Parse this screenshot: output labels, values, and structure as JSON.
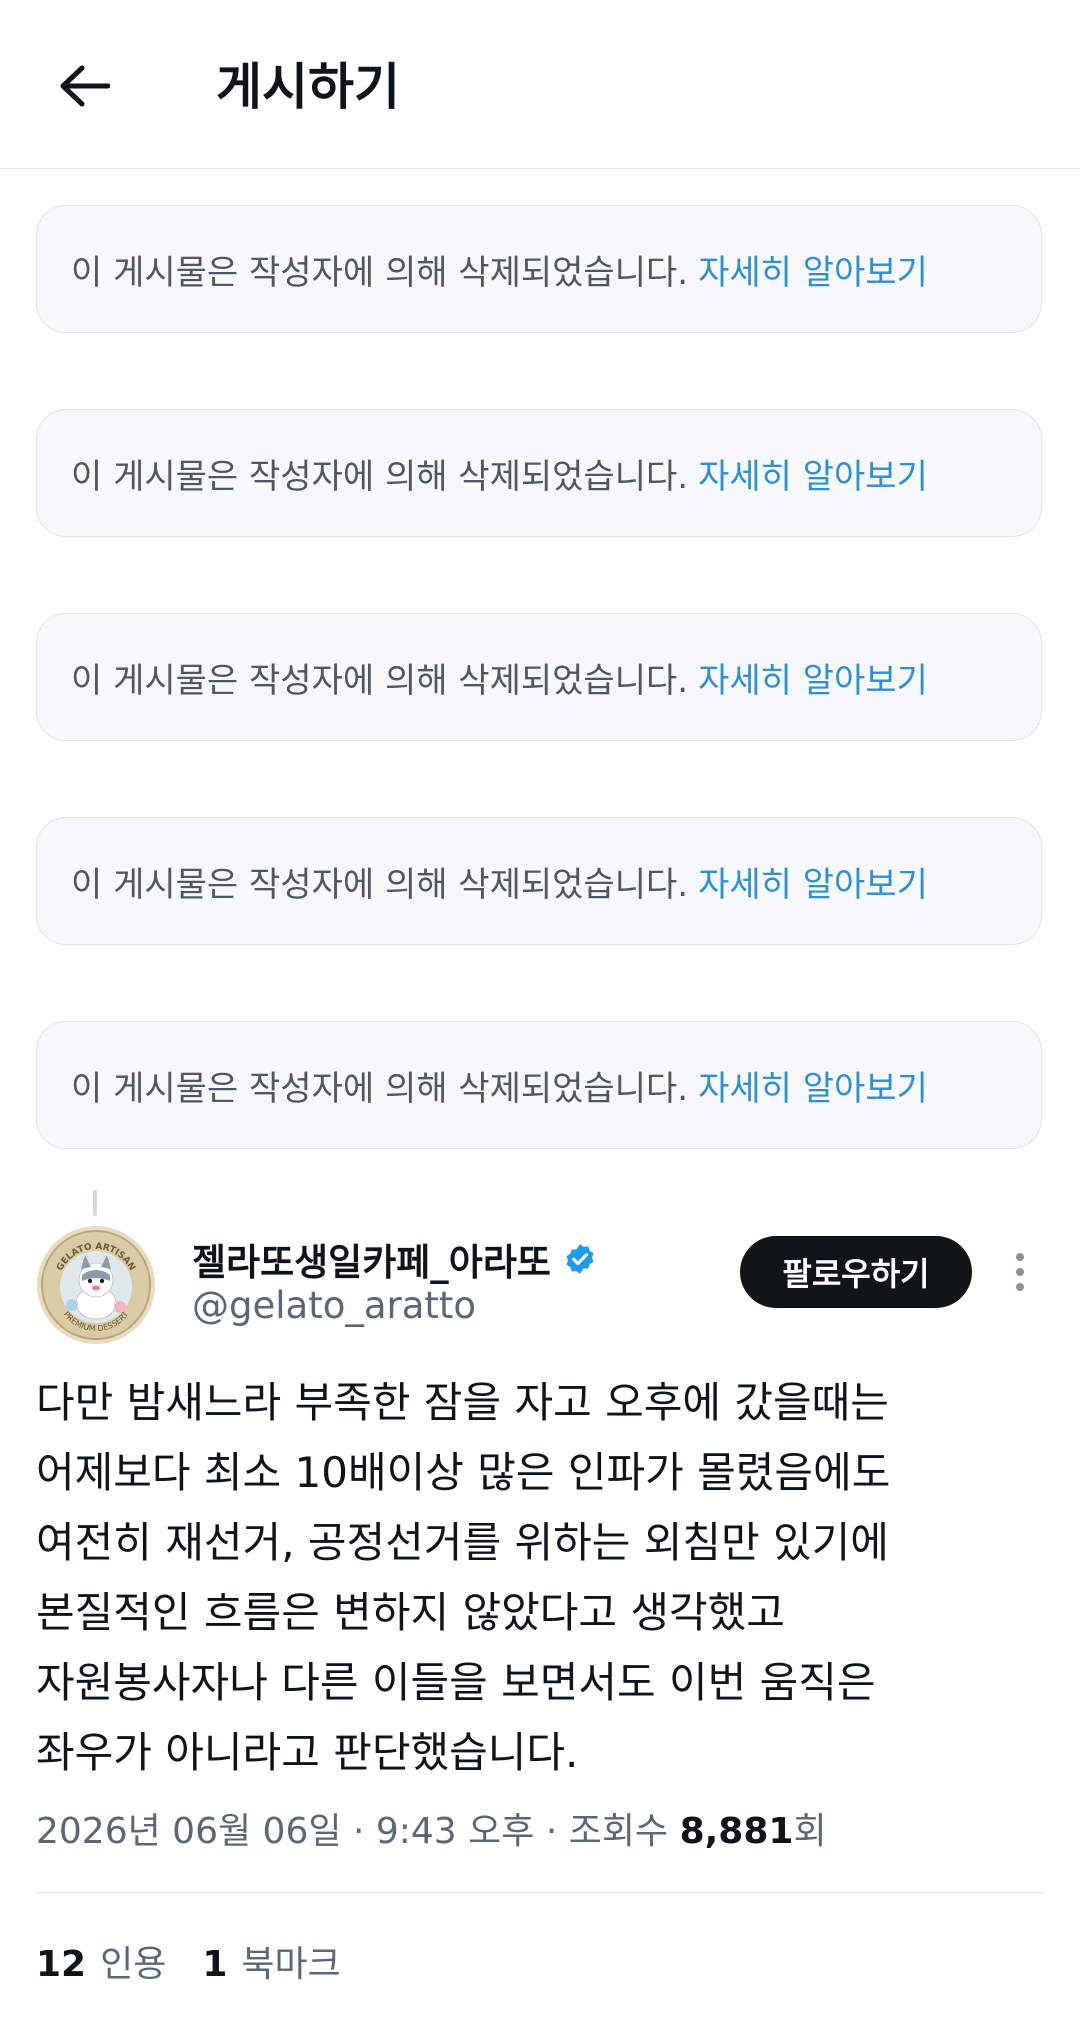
{
  "header": {
    "title": "게시하기"
  },
  "deleted_posts": [
    {
      "message": "이 게시물은 작성자에 의해 삭제되었습니다.",
      "link": "자세히 알아보기"
    },
    {
      "message": "이 게시물은 작성자에 의해 삭제되었습니다.",
      "link": "자세히 알아보기"
    },
    {
      "message": "이 게시물은 작성자에 의해 삭제되었습니다.",
      "link": "자세히 알아보기"
    },
    {
      "message": "이 게시물은 작성자에 의해 삭제되었습니다.",
      "link": "자세히 알아보기"
    },
    {
      "message": "이 게시물은 작성자에 의해 삭제되었습니다.",
      "link": "자세히 알아보기"
    }
  ],
  "post": {
    "author_name": "젤라또생일카페_아라또",
    "author_handle": "@gelato_aratto",
    "verified": true,
    "avatar_text": "GELATO ARTISAN · PREMIUM DESSERT",
    "follow_label": "팔로우하기",
    "lines": [
      "다만 밤새느라 부족한 잠을 자고 오후에 갔을때는",
      "어제보다 최소 10배이상 많은 인파가 몰렸음에도",
      "여전히 재선거, 공정선거를 위하는 외침만 있기에",
      "본질적인 흐름은 변하지 않았다고 생각했고",
      "자원봉사자나 다른 이들을 보면서도 이번 움직은",
      "좌우가 아니라고 판단했습니다."
    ],
    "date": "2026년 06월 06일",
    "time": "9:43 오후",
    "views_label": "조회수",
    "views_count": "8,881",
    "views_suffix": "회",
    "separator": "·",
    "quotes_count": "12",
    "quotes_label": "인용",
    "bookmarks_count": "1",
    "bookmarks_label": "북마크"
  },
  "colors": {
    "link": "#2f8fcf",
    "verified_badge": "#1d9bf0",
    "follow_bg": "#0f1419",
    "notice_bg": "#f6f8f9"
  },
  "icons": {
    "back": "arrow-left-icon",
    "verified": "verified-badge-icon",
    "more": "more-vertical-icon"
  }
}
